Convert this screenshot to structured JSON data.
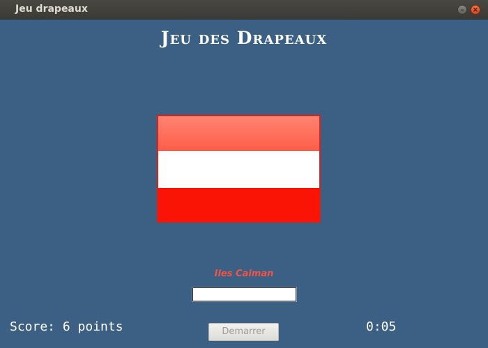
{
  "window": {
    "title": "Jeu drapeaux",
    "minimize_glyph": "–",
    "close_glyph": "×"
  },
  "game": {
    "title": "Jeu des Drapeaux",
    "country_name": "Iles Caiman",
    "flag": {
      "stripes": [
        "#fe6b57",
        "#ffffff",
        "#f91406"
      ],
      "border_color": "#d8231c"
    },
    "answer_input": {
      "value": "",
      "placeholder": ""
    },
    "score": "Score: 6 points",
    "start_button": "Demarrer",
    "timer": "0:05"
  },
  "colors": {
    "background": "#3c5f84",
    "title_text": "#ffffff",
    "country_text": "#f25446",
    "titlebar": "#3b3a36"
  }
}
